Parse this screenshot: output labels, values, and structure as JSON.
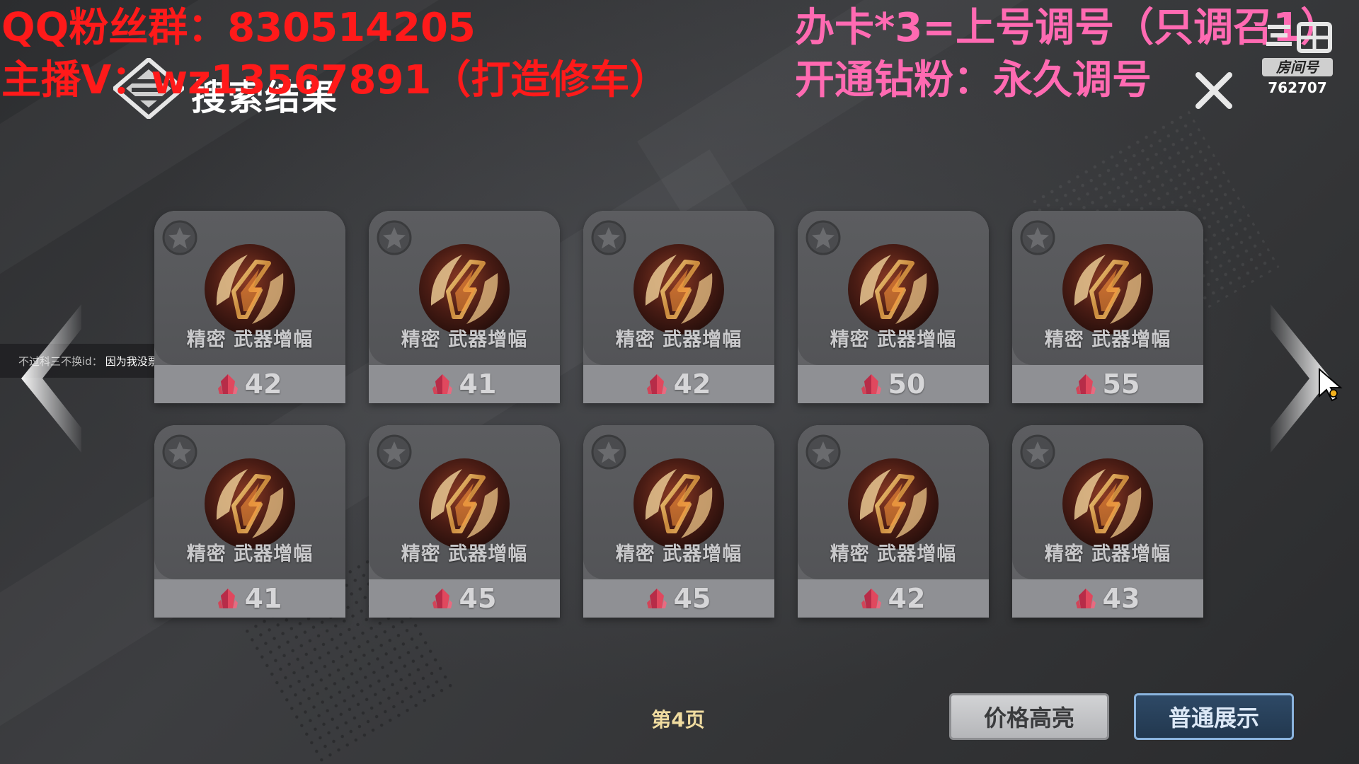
{
  "header": {
    "title": "搜索结果"
  },
  "overlays": {
    "qq_group": "QQ粉丝群：830514205",
    "streamer_v": "主播V：wz13567891（打造修车）",
    "promo_line1": "办卡*3=上号调号（只调召1）",
    "promo_line2": "开通钻粉：永久调号",
    "room_label": "房间号",
    "room_id": "762707"
  },
  "chat": {
    "user": "不过科三不换id：",
    "message": "因为我没票了"
  },
  "items": [
    {
      "name": "精密 武器增幅",
      "price": "42"
    },
    {
      "name": "精密 武器增幅",
      "price": "41"
    },
    {
      "name": "精密 武器增幅",
      "price": "42"
    },
    {
      "name": "精密 武器增幅",
      "price": "50"
    },
    {
      "name": "精密 武器增幅",
      "price": "55"
    },
    {
      "name": "精密 武器增幅",
      "price": "41"
    },
    {
      "name": "精密 武器增幅",
      "price": "45"
    },
    {
      "name": "精密 武器增幅",
      "price": "45"
    },
    {
      "name": "精密 武器增幅",
      "price": "42"
    },
    {
      "name": "精密 武器增幅",
      "price": "43"
    }
  ],
  "pagination": {
    "page_label": "第4页"
  },
  "buttons": {
    "price_highlight": "价格高亮",
    "normal_display": "普通展示"
  },
  "colors": {
    "overlay_red": "#ff1a1a",
    "overlay_pink": "#ff6ab2",
    "page_label": "#f0dca0",
    "normal_button_border": "#8bb4de"
  },
  "icons": {
    "header_logo": "diamond-logo-icon",
    "close": "close-icon",
    "favorite": "star-icon",
    "item": "weapon-amplify-icon",
    "currency": "crystal-icon",
    "prev": "chevron-left-icon",
    "next": "chevron-right-icon"
  }
}
